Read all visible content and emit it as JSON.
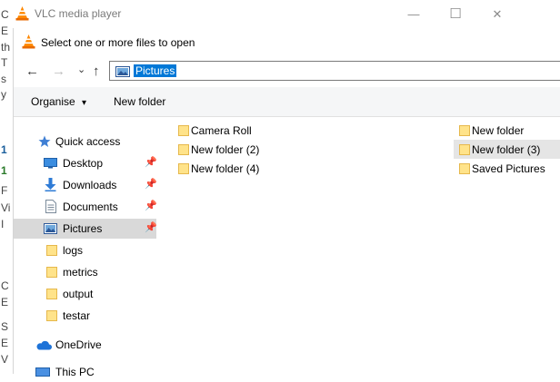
{
  "background_app": {
    "chars": [
      "C",
      "E",
      "th",
      "T",
      "s",
      "y",
      "1",
      "1",
      "F",
      "Vi",
      "I",
      "C",
      "E",
      "S",
      "E",
      "V"
    ]
  },
  "window": {
    "title": "VLC media player",
    "minimize_glyph": "—",
    "maximize_glyph": "☐",
    "close_glyph": "✕"
  },
  "dialog": {
    "title": "Select one or more files to open",
    "nav": {
      "back": "←",
      "forward": "→",
      "recent": "⌄",
      "up": "↑"
    },
    "address": "Pictures",
    "toolbar": {
      "organise": "Organise",
      "organise_caret": "▾",
      "new_folder": "New folder"
    },
    "nav_pane": {
      "quick_access": "Quick access",
      "items": [
        {
          "label": "Desktop",
          "icon": "desktop-icon",
          "pinned": true
        },
        {
          "label": "Downloads",
          "icon": "downloads-icon",
          "pinned": true
        },
        {
          "label": "Documents",
          "icon": "documents-icon",
          "pinned": true
        },
        {
          "label": "Pictures",
          "icon": "pictures-icon",
          "pinned": true,
          "selected": true
        },
        {
          "label": "logs",
          "icon": "folder-icon",
          "pinned": false
        },
        {
          "label": "metrics",
          "icon": "folder-icon",
          "pinned": false
        },
        {
          "label": "output",
          "icon": "folder-icon",
          "pinned": false
        },
        {
          "label": "testar",
          "icon": "folder-icon",
          "pinned": false
        }
      ],
      "onedrive": "OneDrive",
      "this_pc": "This PC",
      "pin_glyph": "📌"
    },
    "files": [
      {
        "label": "Camera Roll"
      },
      {
        "label": "New folder (2)"
      },
      {
        "label": "New folder (4)"
      },
      {
        "label": "New folder"
      },
      {
        "label": "New folder (3)",
        "selected": true
      },
      {
        "label": "Saved Pictures"
      }
    ]
  },
  "colors": {
    "accent": "#0078d7",
    "folder": "#ffd966",
    "folder_dark": "#e6b84c",
    "selection": "#d9d9d9",
    "vlc_orange": "#ff8800"
  }
}
